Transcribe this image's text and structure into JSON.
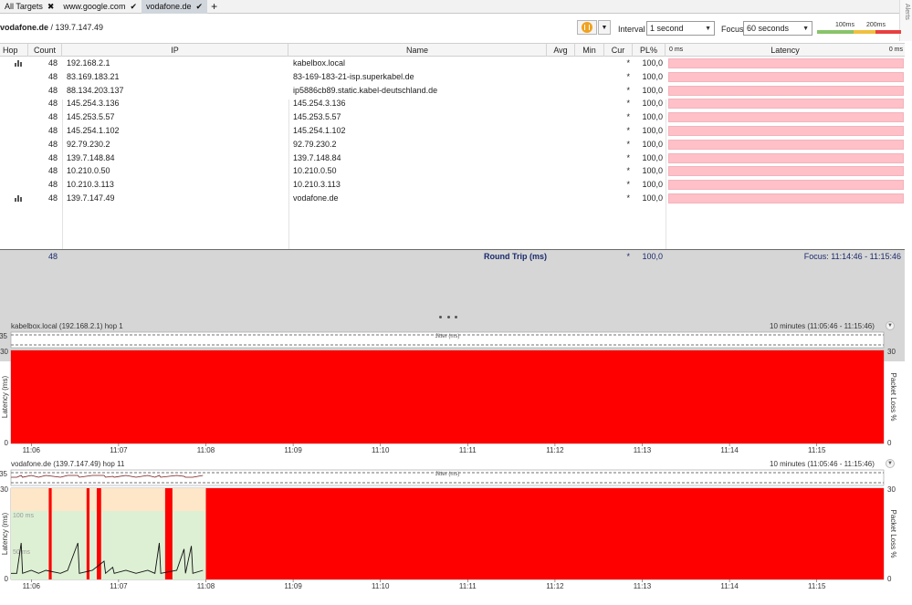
{
  "tabs": [
    {
      "label": "All Targets",
      "glyph": "✖"
    },
    {
      "label": "www.google.com",
      "glyph": "✔"
    },
    {
      "label": "vodafone.de",
      "glyph": "✔",
      "active": true
    }
  ],
  "tab_add": "+",
  "alerts_label": "Alerts",
  "header": {
    "host": "vodafone.de",
    "ip": " / 139.7.147.49"
  },
  "toolbar": {
    "interval_label": "Interval",
    "interval_value": "1 second",
    "focus_label": "Focus",
    "focus_value": "60 seconds",
    "scale_100": "100ms",
    "scale_200": "200ms",
    "scale_colors": {
      "good": "#88c46a",
      "warn": "#f0c040",
      "bad": "#e84040"
    }
  },
  "columns": {
    "hop": "Hop",
    "count": "Count",
    "ip": "IP",
    "name": "Name",
    "avg": "Avg",
    "min": "Min",
    "cur": "Cur",
    "pl": "PL%",
    "lat_left": "0 ms",
    "latency": "Latency",
    "lat_right": "0 ms"
  },
  "rows": [
    {
      "count": "48",
      "ip": "192.168.2.1",
      "name": "kabelbox.local",
      "cur": "*",
      "pl": "100,0",
      "icon": true
    },
    {
      "count": "48",
      "ip": "83.169.183.21",
      "name": "83-169-183-21-isp.superkabel.de",
      "cur": "*",
      "pl": "100,0"
    },
    {
      "count": "48",
      "ip": "88.134.203.137",
      "name": "ip5886cb89.static.kabel-deutschland.de",
      "cur": "*",
      "pl": "100,0"
    },
    {
      "count": "48",
      "ip": "145.254.3.136",
      "name": "145.254.3.136",
      "cur": "*",
      "pl": "100,0"
    },
    {
      "count": "48",
      "ip": "145.253.5.57",
      "name": "145.253.5.57",
      "cur": "*",
      "pl": "100,0"
    },
    {
      "count": "48",
      "ip": "145.254.1.102",
      "name": "145.254.1.102",
      "cur": "*",
      "pl": "100,0"
    },
    {
      "count": "48",
      "ip": "92.79.230.2",
      "name": "92.79.230.2",
      "cur": "*",
      "pl": "100,0"
    },
    {
      "count": "48",
      "ip": "139.7.148.84",
      "name": "139.7.148.84",
      "cur": "*",
      "pl": "100,0"
    },
    {
      "count": "48",
      "ip": "10.210.0.50",
      "name": "10.210.0.50",
      "cur": "*",
      "pl": "100,0"
    },
    {
      "count": "48",
      "ip": "10.210.3.113",
      "name": "10.210.3.113",
      "cur": "*",
      "pl": "100,0"
    },
    {
      "count": "48",
      "ip": "139.7.147.49",
      "name": "vodafone.de",
      "cur": "*",
      "pl": "100,0",
      "icon": true
    }
  ],
  "total": {
    "count": "48",
    "label": "Round Trip (ms)",
    "cur": "*",
    "pl": "100,0",
    "focus": "Focus: 11:14:46 - 11:15:46"
  },
  "chart_data": [
    {
      "type": "area",
      "title": "kabelbox.local (192.168.2.1) hop 1",
      "range": "10 minutes (11:05:46 - 11:15:46)",
      "ylabel": "Latency (ms)",
      "y2label": "Packet Loss %",
      "jitter_label": "Jitter (ms)",
      "jitter_top": "35",
      "yticks": [
        "30",
        "0"
      ],
      "y2ticks": [
        "30",
        "0"
      ],
      "xticks": [
        "11:06",
        "11:07",
        "11:08",
        "11:09",
        "11:10",
        "11:11",
        "11:12",
        "11:13",
        "11:14",
        "11:15"
      ],
      "packet_loss": {
        "color": "#ff0000",
        "segments": [
          [
            "11:05:46",
            "11:15:46"
          ]
        ]
      },
      "latency_series": []
    },
    {
      "type": "line",
      "title": "vodafone.de (139.7.147.49) hop 11",
      "range": "10 minutes (11:05:46 - 11:15:46)",
      "ylabel": "Latency (ms)",
      "y2label": "Packet Loss %",
      "jitter_label": "Jitter (ms)",
      "jitter_top": "35",
      "yticks": [
        "30",
        "0"
      ],
      "y2ticks": [
        "30",
        "0"
      ],
      "band_labels": [
        "100 ms",
        "50 ms"
      ],
      "xticks": [
        "11:06",
        "11:07",
        "11:08",
        "11:09",
        "11:10",
        "11:11",
        "11:12",
        "11:13",
        "11:14",
        "11:15"
      ],
      "packet_loss": {
        "color": "#ff0000",
        "segments": [
          [
            "11:06:12",
            "11:06:14"
          ],
          [
            "11:06:38",
            "11:06:40"
          ],
          [
            "11:06:45",
            "11:06:48"
          ],
          [
            "11:07:32",
            "11:07:37"
          ],
          [
            "11:08:00",
            "11:15:46"
          ]
        ]
      },
      "latency_series": [
        [
          "11:05:46",
          2
        ],
        [
          "11:05:50",
          2
        ],
        [
          "11:05:53",
          12
        ],
        [
          "11:05:54",
          2
        ],
        [
          "11:06:00",
          3
        ],
        [
          "11:06:05",
          2
        ],
        [
          "11:06:10",
          3
        ],
        [
          "11:06:20",
          2
        ],
        [
          "11:06:25",
          3
        ],
        [
          "11:06:32",
          12
        ],
        [
          "11:06:33",
          2
        ],
        [
          "11:06:42",
          3
        ],
        [
          "11:06:50",
          6
        ],
        [
          "11:06:51",
          2
        ],
        [
          "11:06:56",
          4
        ],
        [
          "11:06:57",
          2
        ],
        [
          "11:07:05",
          3
        ],
        [
          "11:07:12",
          2
        ],
        [
          "11:07:20",
          3
        ],
        [
          "11:07:25",
          2
        ],
        [
          "11:07:28",
          12
        ],
        [
          "11:07:29",
          2
        ],
        [
          "11:07:40",
          3
        ],
        [
          "11:07:45",
          10
        ],
        [
          "11:07:46",
          2
        ],
        [
          "11:07:50",
          11
        ],
        [
          "11:07:51",
          2
        ],
        [
          "11:07:58",
          3
        ]
      ]
    }
  ]
}
